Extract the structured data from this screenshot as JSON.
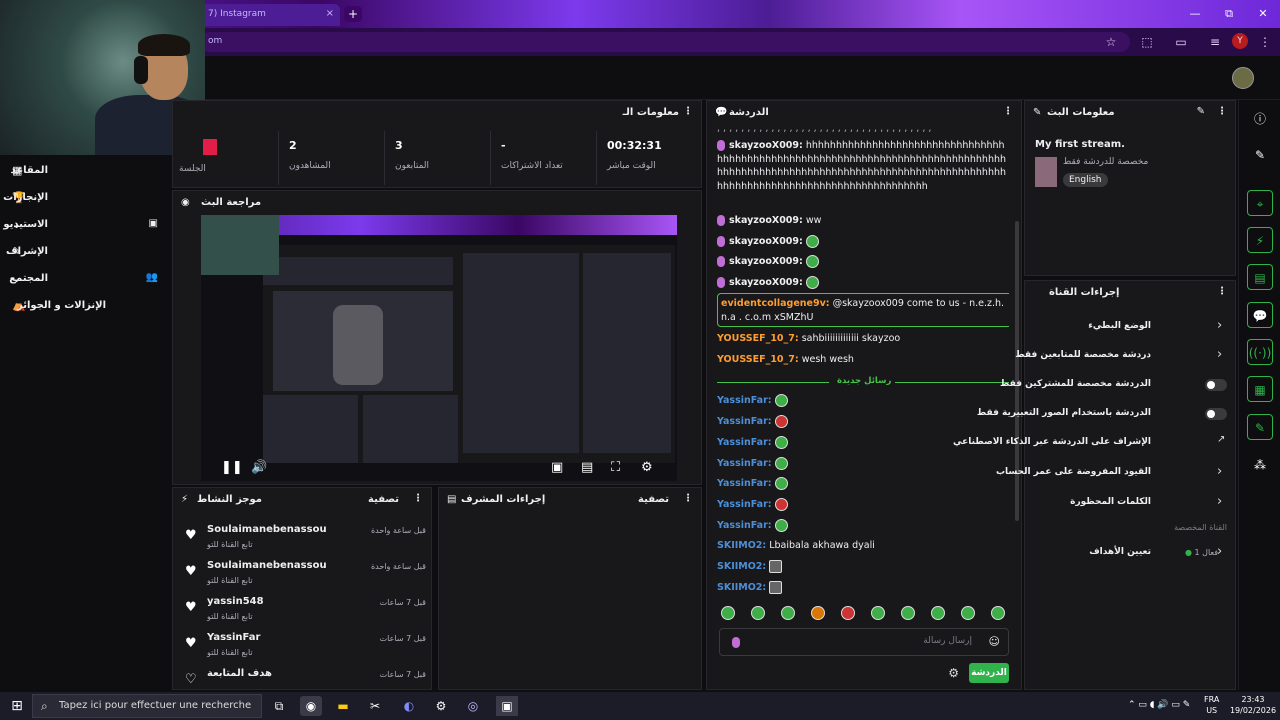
{
  "browser": {
    "tab_title": "7) Instagram",
    "tab_close": "×",
    "new_tab": "+",
    "address": "om",
    "profile_initial": "Y",
    "window_controls": [
      "—",
      "⧉",
      "✕"
    ]
  },
  "stream_info_panel": {
    "title": "معلومات الـ",
    "session_label": "الجلسة",
    "stats": [
      {
        "value": "2",
        "label": "المشاهدون"
      },
      {
        "value": "3",
        "label": "المتابعون"
      },
      {
        "value": "-",
        "label": "تعداد الاشتراكات"
      },
      {
        "value": "00:32:31",
        "label": "الوقت مباشر"
      }
    ]
  },
  "sidebar": {
    "items": [
      {
        "label": "المقاعد"
      },
      {
        "label": "الإنجازات"
      },
      {
        "label": "الاستيديو"
      },
      {
        "label": "الإشراف"
      },
      {
        "label": "المجتمع"
      },
      {
        "label": "الإنزالات و الجوائز"
      }
    ]
  },
  "preview_panel": {
    "title": "مراجعة البث"
  },
  "activity_feed": {
    "title": "موجز النشاط",
    "filter": "تصفية",
    "items": [
      {
        "name": "Soulaimanebenassou",
        "sub": "تابع القناة للتو",
        "time": "قبل ساعة واحدة"
      },
      {
        "name": "Soulaimanebenassou",
        "sub": "تابع القناة للتو",
        "time": "قبل ساعة واحدة"
      },
      {
        "name": "yassin548",
        "sub": "تابع القناة للتو",
        "time": "قبل 7 ساعات"
      },
      {
        "name": "YassinFar",
        "sub": "تابع القناة للتو",
        "time": "قبل 7 ساعات"
      },
      {
        "name": "هدف المتابعة",
        "sub": "",
        "time": "قبل 7 ساعات"
      }
    ]
  },
  "mod_actions": {
    "title": "إجراءات المشرف",
    "filter": "تصفية"
  },
  "chat": {
    "title": "الدردشة",
    "messages": [
      {
        "user": "",
        "text": ", , , , , , , , , , , , , , , , , , , , , , , , , , , , , , , , , , , ,",
        "color": "#efeff1"
      },
      {
        "user": "skayzooX009:",
        "text": " hhhhhhhhhhhhhhhhhhhhhhhhhhhhhhhhhhhhhhhhhhhhhhhhhhhhhhhhhhhhhhhhhhhhhhhhhhhhhhhhhhhhhhhhhhhhhhhhhhhhhhhhhhhhhhhhhhhhhhhhhhhhhhhhhhhhhhhhhhhhhhhhhhhhhhhhhhhhhhhhhhhh",
        "color": "#efeff1"
      },
      {
        "user": "skayzooX009:",
        "text": " ww",
        "color": "#efeff1"
      },
      {
        "user": "skayzooX009:",
        "text": "",
        "color": "#efeff1"
      },
      {
        "user": "skayzooX009:",
        "text": "",
        "color": "#efeff1"
      },
      {
        "user": "skayzooX009:",
        "text": "",
        "color": "#efeff1"
      },
      {
        "user": "evidentcollagene9v:",
        "text": " @skayzoox009 come to us - n.e.z.h.n.a . c.o.m xSMZhU",
        "color": "#ff9d2e"
      },
      {
        "user": "YOUSSEF_10_7:",
        "text": " sahbiiiiiiiiiiiii skayzoo",
        "color": "#ff9d2e"
      },
      {
        "user": "YOUSSEF_10_7:",
        "text": " wesh wesh",
        "color": "#ff9d2e"
      },
      {
        "user": "YassinFar:",
        "text": "",
        "color": "#4d8fd6"
      },
      {
        "user": "YassinFar:",
        "text": "",
        "color": "#4d8fd6"
      },
      {
        "user": "YassinFar:",
        "text": "",
        "color": "#4d8fd6"
      },
      {
        "user": "YassinFar:",
        "text": "",
        "color": "#4d8fd6"
      },
      {
        "user": "YassinFar:",
        "text": "",
        "color": "#4d8fd6"
      },
      {
        "user": "YassinFar:",
        "text": "",
        "color": "#4d8fd6"
      },
      {
        "user": "YassinFar:",
        "text": "",
        "color": "#4d8fd6"
      },
      {
        "user": "SKIIMO2:",
        "text": " Lbaibala akhawa dyali",
        "color": "#4d8fd6"
      },
      {
        "user": "SKIIMO2:",
        "text": "",
        "color": "#4d8fd6"
      },
      {
        "user": "SKIIMO2:",
        "text": "",
        "color": "#4d8fd6"
      }
    ],
    "new_messages_divider": "رسائل جديدة",
    "input_placeholder": "إرسال رسالة",
    "send_label": "الدردشة"
  },
  "stream_info": {
    "title": "معلومات البث",
    "stream_title": "My first stream.",
    "category": "مخصصة للدردشة فقط",
    "language": "English"
  },
  "channel_actions": {
    "title": "إجراءات القناة",
    "items": [
      {
        "label": "الوضع البطيء",
        "control": "chevron"
      },
      {
        "label": "دردشة مخصصة للمتابعين فقط",
        "control": "chevron"
      },
      {
        "label": "الدردشة مخصصة للمشتركين فقط",
        "control": "toggle"
      },
      {
        "label": "الدردشة باستخدام الصور التعبيرية فقط",
        "control": "toggle"
      },
      {
        "label": "الإشراف على الدردشة عبر الذكاء الاصطناعي",
        "control": "external"
      },
      {
        "label": "القيود المفروضة على عمر الحساب",
        "control": "chevron"
      },
      {
        "label": "الكلمات المحظورة",
        "control": "chevron"
      }
    ],
    "custom_channel": "القناة المخصصة",
    "goals_label": "تعيين الأهداف",
    "goals_badge": "فعال 1"
  },
  "taskbar": {
    "search_placeholder": "Tapez ici pour effectuer une recherche",
    "lang": "FRA",
    "region": "US",
    "time": "23:43",
    "date": "19/02/2026"
  },
  "colors": {
    "accent_green": "#2fb34a",
    "chat_orange": "#ff9d2e",
    "chat_blue": "#4d8fd6",
    "brand_purple": "#7c3aed"
  }
}
